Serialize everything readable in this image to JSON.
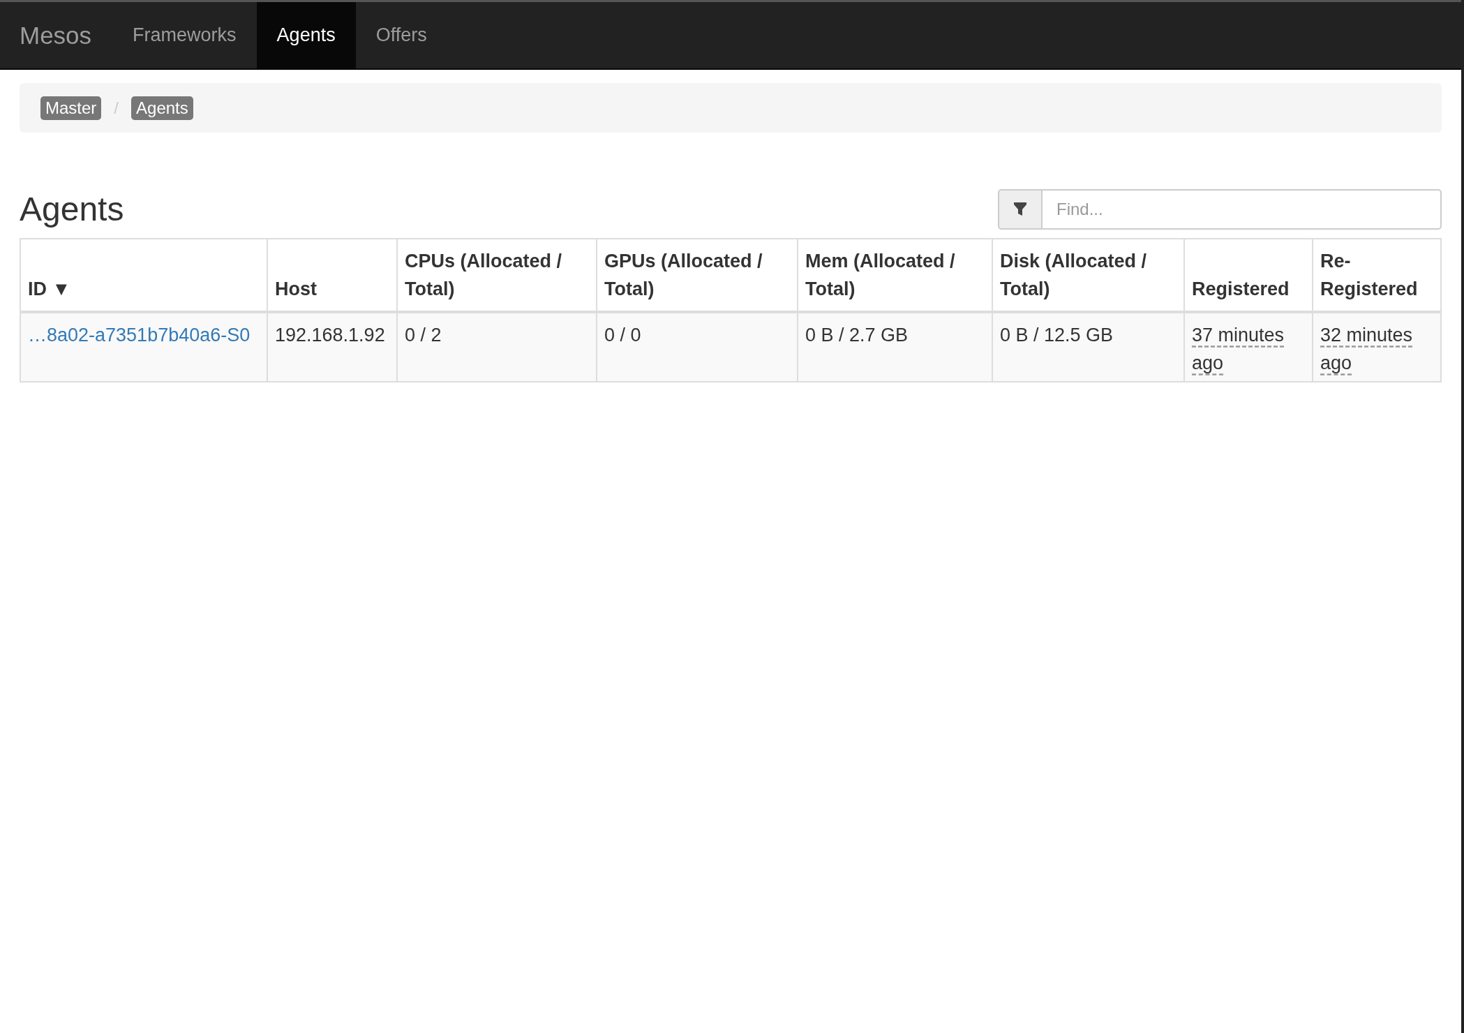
{
  "navbar": {
    "brand": "Mesos",
    "tabs": [
      {
        "label": "Frameworks",
        "selected": false
      },
      {
        "label": "Agents",
        "selected": true
      },
      {
        "label": "Offers",
        "selected": false
      }
    ]
  },
  "breadcrumb": {
    "separator": "/",
    "items": [
      "Master",
      "Agents"
    ]
  },
  "heading": "Agents",
  "filter": {
    "placeholder": "Find..."
  },
  "table": {
    "columns": [
      {
        "label": "ID",
        "sort_indicator": "▼"
      },
      {
        "label": "Host"
      },
      {
        "label": "CPUs (Allocated / Total)"
      },
      {
        "label": "GPUs (Allocated / Total)"
      },
      {
        "label": "Mem (Allocated / Total)"
      },
      {
        "label": "Disk (Allocated / Total)"
      },
      {
        "label": "Registered"
      },
      {
        "label": "Re-Registered"
      }
    ],
    "rows": [
      {
        "cells": [
          {
            "kind": "link",
            "text": "…8a02-a7351b7b40a6-S0"
          },
          {
            "kind": "text",
            "text": "192.168.1.92"
          },
          {
            "kind": "text",
            "text": "0 / 2"
          },
          {
            "kind": "text",
            "text": "0 / 0"
          },
          {
            "kind": "text",
            "text": "0 B / 2.7 GB"
          },
          {
            "kind": "text",
            "text": "0 B / 12.5 GB"
          },
          {
            "kind": "time",
            "text": "37 minutes ago"
          },
          {
            "kind": "time",
            "text": "32 minutes ago"
          }
        ]
      }
    ]
  }
}
